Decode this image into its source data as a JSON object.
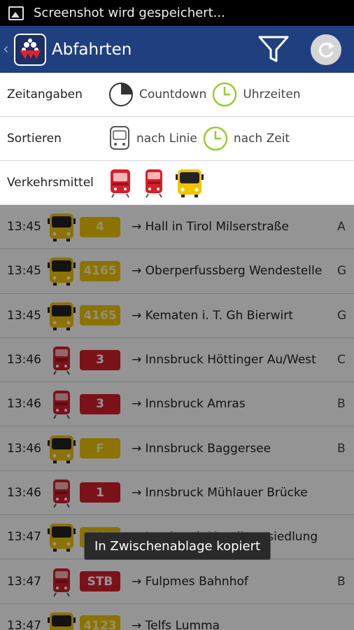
{
  "status_bar": {
    "text": "Screenshot wird gespeichert..."
  },
  "action_bar": {
    "title": "Abfahrten"
  },
  "options": {
    "zeitangaben": {
      "label": "Zeitangaben",
      "opt1": "Countdown",
      "opt2": "Uhrzeiten"
    },
    "sortieren": {
      "label": "Sortieren",
      "opt1": "nach Linie",
      "opt2": "nach Zeit"
    },
    "verkehrsmittel": {
      "label": "Verkehrsmittel"
    }
  },
  "departures": [
    {
      "time": "13:45",
      "vehicle": "bus",
      "line": "4",
      "color": "yellow",
      "dest": "→ Hall in Tirol Milserstraße",
      "platform": "A"
    },
    {
      "time": "13:45",
      "vehicle": "bus",
      "line": "4165",
      "color": "yellow",
      "dest": "→ Oberperfussberg Wendestelle",
      "platform": "G"
    },
    {
      "time": "13:45",
      "vehicle": "bus",
      "line": "4165",
      "color": "yellow",
      "dest": "→ Kematen i. T. Gh Bierwirt",
      "platform": "G"
    },
    {
      "time": "13:46",
      "vehicle": "tram",
      "line": "3",
      "color": "red",
      "dest": "→ Innsbruck Höttinger Au/West",
      "platform": "C"
    },
    {
      "time": "13:46",
      "vehicle": "tram",
      "line": "3",
      "color": "red",
      "dest": "→ Innsbruck Amras",
      "platform": "B"
    },
    {
      "time": "13:46",
      "vehicle": "bus",
      "line": "F",
      "color": "yellow",
      "dest": "→ Innsbruck Baggersee",
      "platform": "B"
    },
    {
      "time": "13:46",
      "vehicle": "tram",
      "line": "1",
      "color": "red",
      "dest": "→ Innsbruck Mühlauer Brücke",
      "platform": ""
    },
    {
      "time": "13:47",
      "vehicle": "bus",
      "line": "M",
      "color": "yellow",
      "dest": "→ Innsbruck Mentlbergsiedlung",
      "platform": ""
    },
    {
      "time": "13:47",
      "vehicle": "tram",
      "line": "STB",
      "color": "red",
      "dest": "→ Fulpmes Bahnhof",
      "platform": "B"
    },
    {
      "time": "13:47",
      "vehicle": "bus",
      "line": "4123",
      "color": "yellow",
      "dest": "→ Telfs Lumma",
      "platform": ""
    }
  ],
  "toast": {
    "text": "In Zwischenablage kopiert"
  },
  "colors": {
    "action_bar": "#1f3f7f",
    "line_yellow": "#f2c400",
    "line_red": "#d6202b",
    "clock_green": "#9acd32"
  }
}
